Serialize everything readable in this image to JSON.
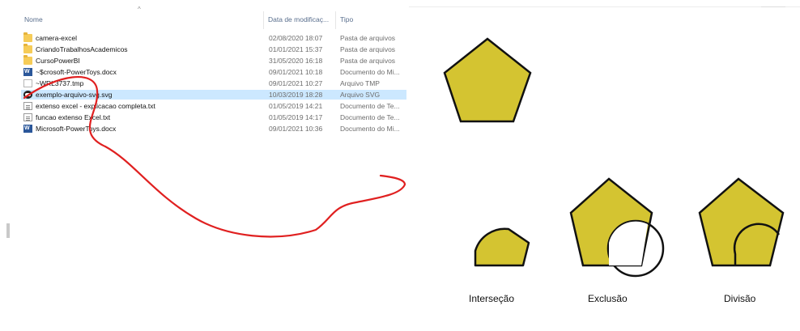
{
  "explorer": {
    "columns": {
      "name": "Nome",
      "date": "Data de modificaç...",
      "type": "Tipo"
    },
    "files": [
      {
        "name": "camera-excel",
        "date": "02/08/2020 18:07",
        "type": "Pasta de arquivos",
        "icon": "folder-icon"
      },
      {
        "name": "CriandoTrabalhosAcademicos",
        "date": "01/01/2021 15:37",
        "type": "Pasta de arquivos",
        "icon": "folder-icon"
      },
      {
        "name": "CursoPowerBI",
        "date": "31/05/2020 16:18",
        "type": "Pasta de arquivos",
        "icon": "folder-icon"
      },
      {
        "name": "~$crosoft-PowerToys.docx",
        "date": "09/01/2021 10:18",
        "type": "Documento do Mi...",
        "icon": "word-doc-icon"
      },
      {
        "name": "~WRL3737.tmp",
        "date": "09/01/2021 10:27",
        "type": "Arquivo TMP",
        "icon": "tmp-file-icon"
      },
      {
        "name": "exemplo-arquivo-svg.svg",
        "date": "10/03/2019 18:28",
        "type": "Arquivo SVG",
        "icon": "inkscape-svg-icon",
        "selected": true
      },
      {
        "name": "extenso excel - explicacao completa.txt",
        "date": "01/05/2019 14:21",
        "type": "Documento de Te...",
        "icon": "text-file-icon"
      },
      {
        "name": "funcao extenso Excel.txt",
        "date": "01/05/2019 14:17",
        "type": "Documento de Te...",
        "icon": "text-file-icon"
      },
      {
        "name": "Microsoft-PowerToys.docx",
        "date": "09/01/2021 10:36",
        "type": "Documento do Mi...",
        "icon": "word-doc-icon"
      }
    ]
  },
  "preview": {
    "fill_color": "#d4c431",
    "stroke_color": "#111111",
    "arrow_color": "#e02020",
    "captions": {
      "intersection": "Interseção",
      "exclusion": "Exclusão",
      "division": "Divisão"
    }
  }
}
